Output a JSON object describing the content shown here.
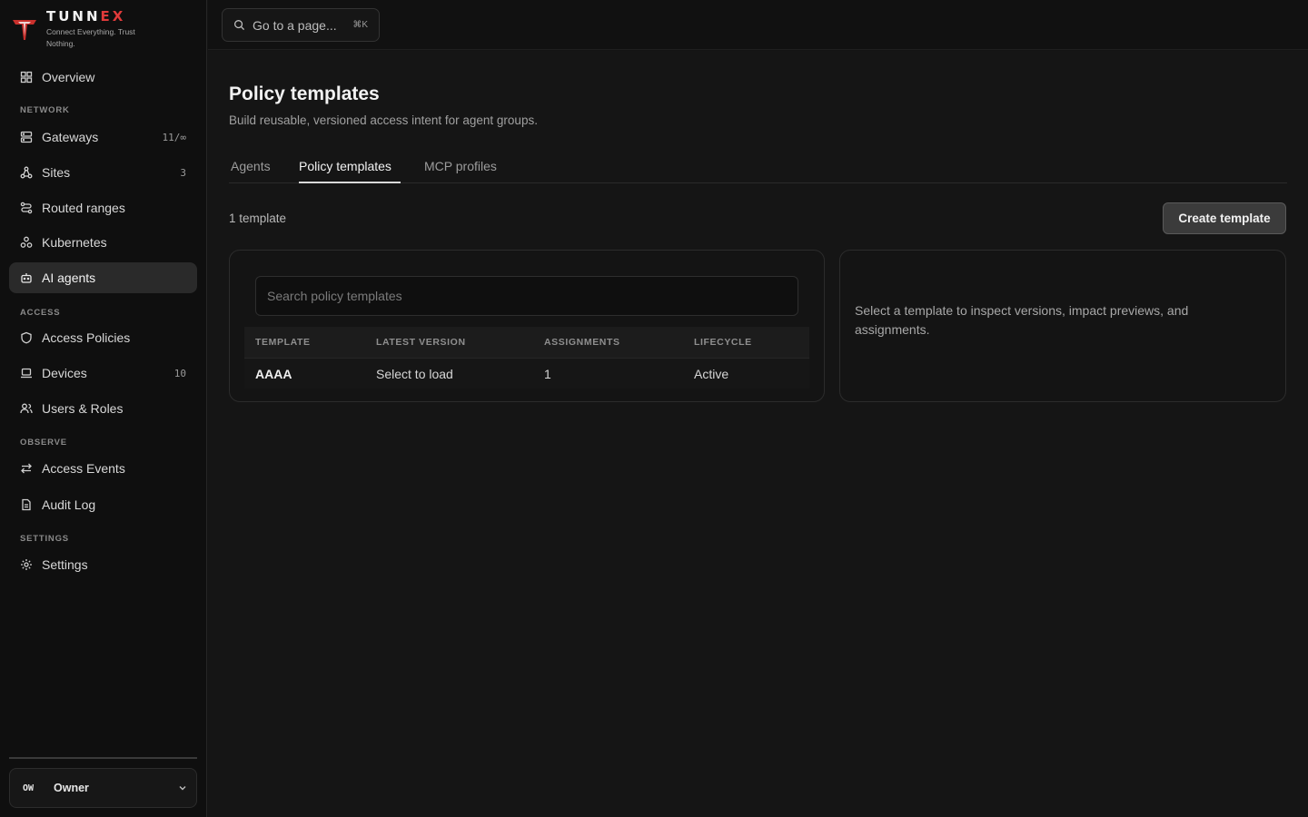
{
  "brand": {
    "name_main": "TUNN",
    "name_accent": "EX",
    "tagline": "Connect Everything. Trust Nothing.",
    "accent_color": "#e03a3a"
  },
  "sidebar": {
    "overview": {
      "label": "Overview",
      "icon": "grid-icon"
    },
    "sections": {
      "network": "NETWORK",
      "access": "ACCESS",
      "observe": "OBSERVE",
      "settings": "SETTINGS"
    },
    "items": {
      "gateways": {
        "label": "Gateways",
        "count": "11/∞",
        "icon": "server-icon"
      },
      "sites": {
        "label": "Sites",
        "count": "3",
        "icon": "network-icon"
      },
      "routed_ranges": {
        "label": "Routed ranges",
        "icon": "route-icon"
      },
      "kubernetes": {
        "label": "Kubernetes",
        "icon": "cluster-icon"
      },
      "ai_agents": {
        "label": "AI agents",
        "icon": "bot-icon",
        "active": true
      },
      "access_policies": {
        "label": "Access Policies",
        "icon": "shield-icon"
      },
      "devices": {
        "label": "Devices",
        "count": "10",
        "icon": "laptop-icon"
      },
      "users_roles": {
        "label": "Users & Roles",
        "icon": "users-icon"
      },
      "access_events": {
        "label": "Access Events",
        "icon": "arrows-icon"
      },
      "audit_log": {
        "label": "Audit Log",
        "icon": "file-icon"
      },
      "settings": {
        "label": "Settings",
        "icon": "gear-icon"
      }
    },
    "user": {
      "initials": "OW",
      "name": "Owner"
    }
  },
  "topbar": {
    "command_placeholder": "Go to a page...",
    "shortcut": "⌘K"
  },
  "page": {
    "title": "Policy templates",
    "subtitle": "Build reusable, versioned access intent for agent groups.",
    "tabs": [
      {
        "label": "Agents"
      },
      {
        "label": "Policy templates",
        "active": true
      },
      {
        "label": "MCP profiles"
      }
    ],
    "count_text": "1 template",
    "create_button": "Create template",
    "search_placeholder": "Search policy templates",
    "table": {
      "headers": [
        "TEMPLATE",
        "LATEST VERSION",
        "ASSIGNMENTS",
        "LIFECYCLE"
      ],
      "rows": [
        [
          "AAAA",
          "Select to load",
          "1",
          "Active"
        ]
      ]
    },
    "detail_empty": "Select a template to inspect versions, impact previews, and assignments."
  }
}
